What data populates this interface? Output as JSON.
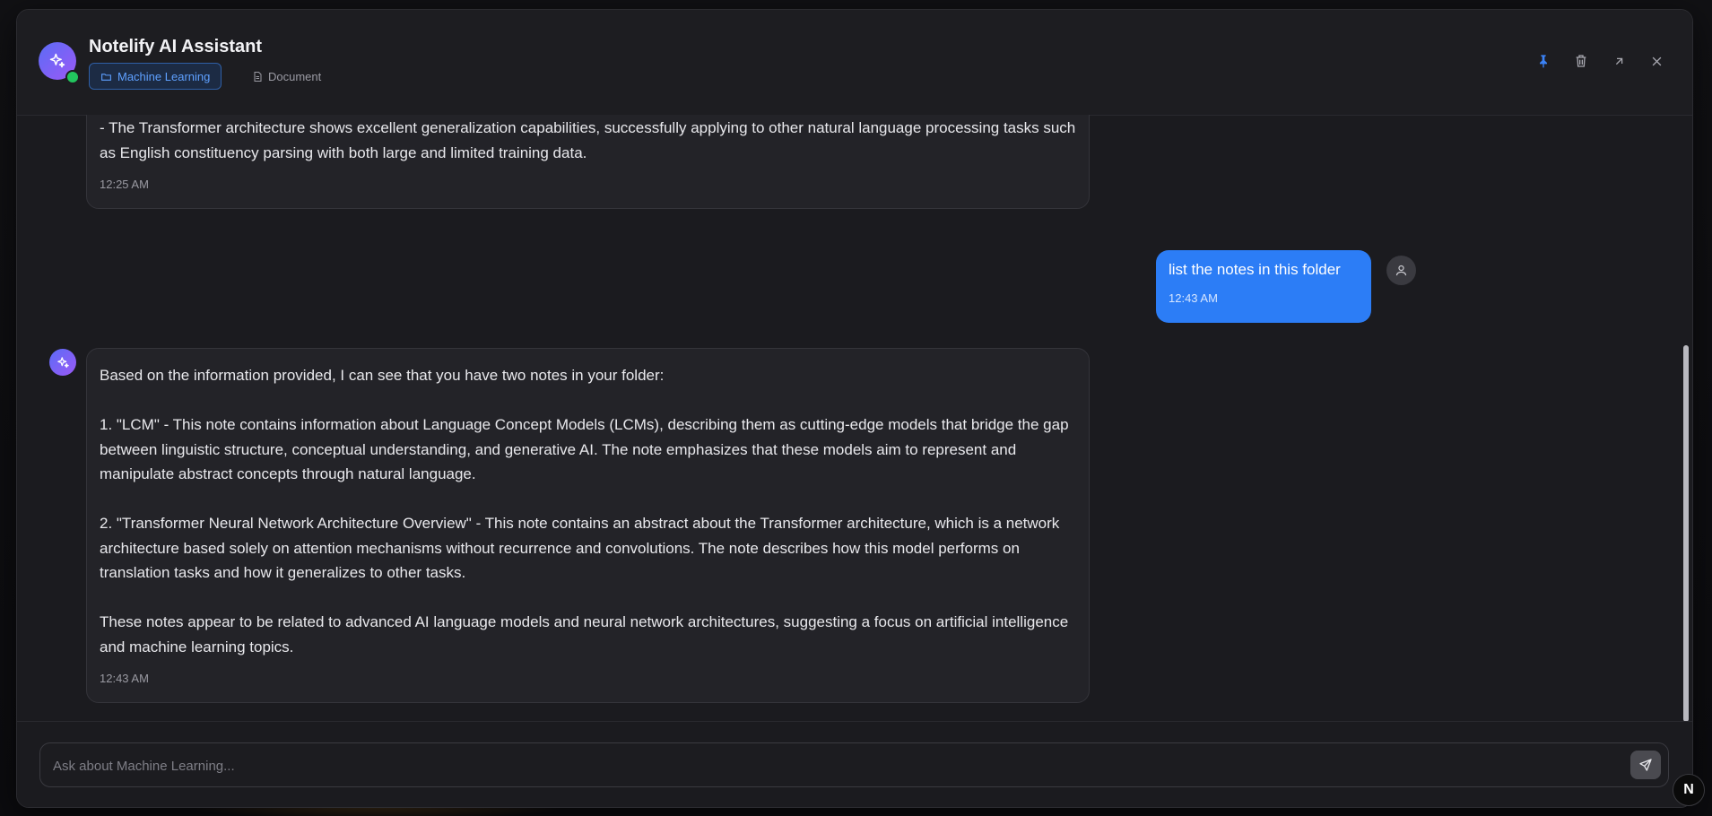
{
  "app": {
    "title": "Notelify AI Assistant",
    "status": "online"
  },
  "context": {
    "folder_label": "Machine Learning",
    "document_label": "Document"
  },
  "header_actions": [
    {
      "name": "pin-icon"
    },
    {
      "name": "trash-icon"
    },
    {
      "name": "expand-icon"
    },
    {
      "name": "close-icon"
    }
  ],
  "messages": [
    {
      "role": "assistant",
      "text": "- The Transformer architecture shows excellent generalization capabilities, successfully applying to other natural language processing tasks such as English constituency parsing with both large and limited training data.",
      "time": "12:25 AM"
    },
    {
      "role": "user",
      "text": "list the notes in this folder",
      "time": "12:43 AM"
    },
    {
      "role": "assistant",
      "text": "Based on the information provided, I can see that you have two notes in your folder:\n\n1. \"LCM\" - This note contains information about Language Concept Models (LCMs), describing them as cutting-edge models that bridge the gap between linguistic structure, conceptual understanding, and generative AI. The note emphasizes that these models aim to represent and manipulate abstract concepts through natural language.\n\n2. \"Transformer Neural Network Architecture Overview\" - This note contains an abstract about the Transformer architecture, which is a network architecture based solely on attention mechanisms without recurrence and convolutions. The note describes how this model performs on translation tasks and how it generalizes to other tasks.\n\nThese notes appear to be related to advanced AI language models and neural network architectures, suggesting a focus on artificial intelligence and machine learning topics.",
      "time": "12:43 AM"
    }
  ],
  "composer": {
    "placeholder": "Ask about Machine Learning...",
    "value": ""
  },
  "badge": {
    "letter": "N"
  },
  "colors": {
    "accent": "#2c7df6",
    "online": "#22c55e",
    "avatar_gradient_start": "#5b6cf7",
    "avatar_gradient_end": "#9b59f5"
  }
}
